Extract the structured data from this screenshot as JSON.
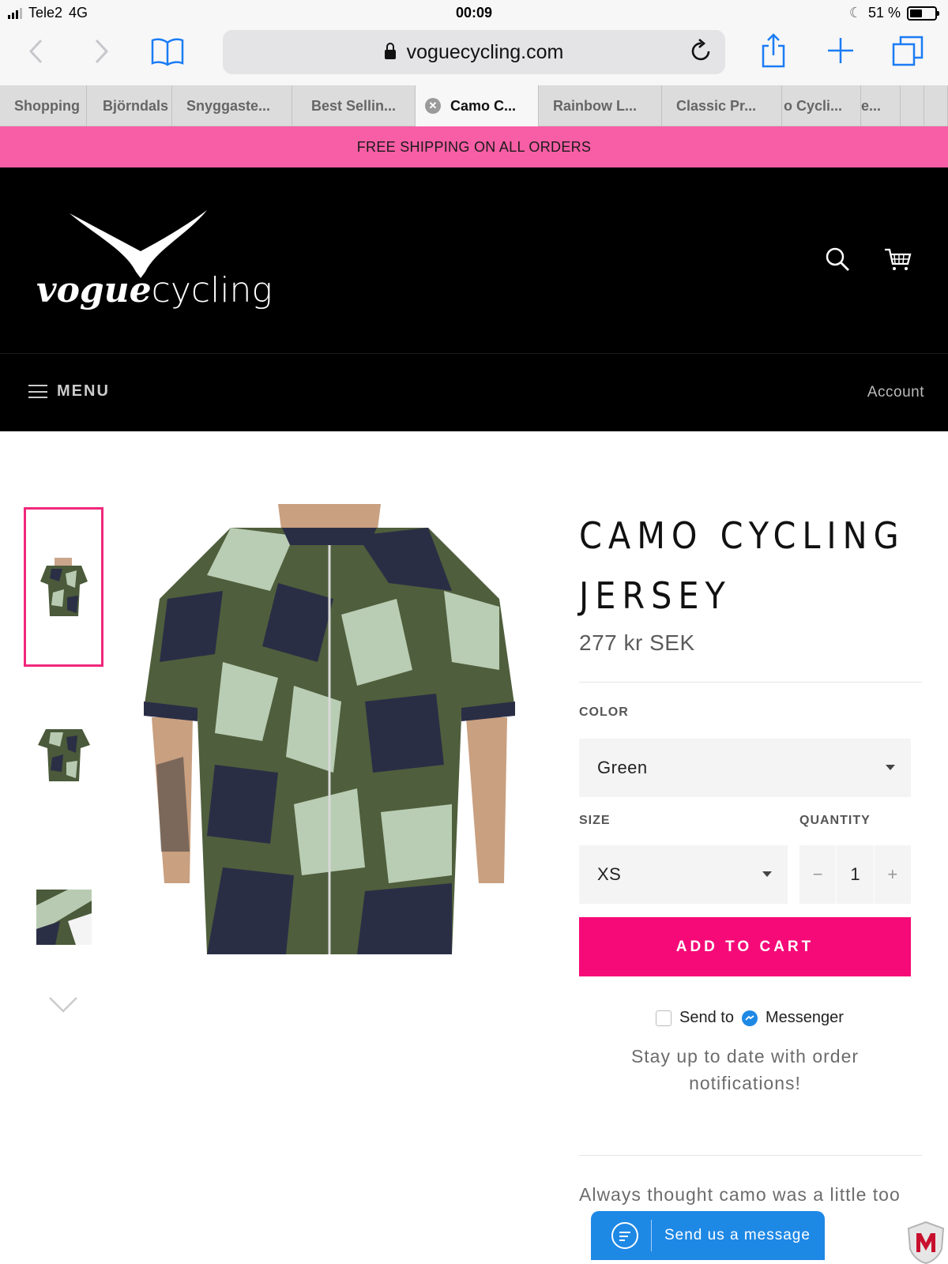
{
  "status_bar": {
    "carrier": "Tele2",
    "network": "4G",
    "time": "00:09",
    "battery": "51 %",
    "battery_level": 0.51
  },
  "browser": {
    "url": "voguecycling.com",
    "tabs": [
      {
        "label": "Shopping"
      },
      {
        "label": "Björndals"
      },
      {
        "label": "Snyggaste..."
      },
      {
        "label": "Best Sellin..."
      },
      {
        "label": "Camo C...",
        "active": true
      },
      {
        "label": "Rainbow L..."
      },
      {
        "label": "Classic Pr..."
      },
      {
        "label": "o Cycli..."
      },
      {
        "label": "e..."
      }
    ]
  },
  "promo": {
    "text": "FREE SHIPPING ON ALL ORDERS",
    "color": "#f75ea5"
  },
  "header": {
    "logo_text_bold": "vogue",
    "logo_text_light": "cycling",
    "search_icon": "search-icon",
    "cart_icon": "cart-icon"
  },
  "nav": {
    "menu_label": "MENU",
    "account_label": "Account"
  },
  "product": {
    "title": "CAMO CYCLING JERSEY",
    "price": "277 kr SEK",
    "color_label": "COLOR",
    "color_value": "Green",
    "size_label": "SIZE",
    "size_value": "XS",
    "quantity_label": "QUANTITY",
    "quantity_value": "1",
    "qty_minus": "−",
    "qty_plus": "+",
    "add_to_cart": "ADD TO CART",
    "accent_color": "#f50a78"
  },
  "messenger": {
    "send_to": "Send to",
    "messenger": "Messenger",
    "notify_text": "Stay up to date with order notifications!"
  },
  "description": {
    "visible_text": "Always thought camo was a little too"
  },
  "chat_widget": {
    "label": "Send us a message",
    "color": "#1e88e5"
  }
}
